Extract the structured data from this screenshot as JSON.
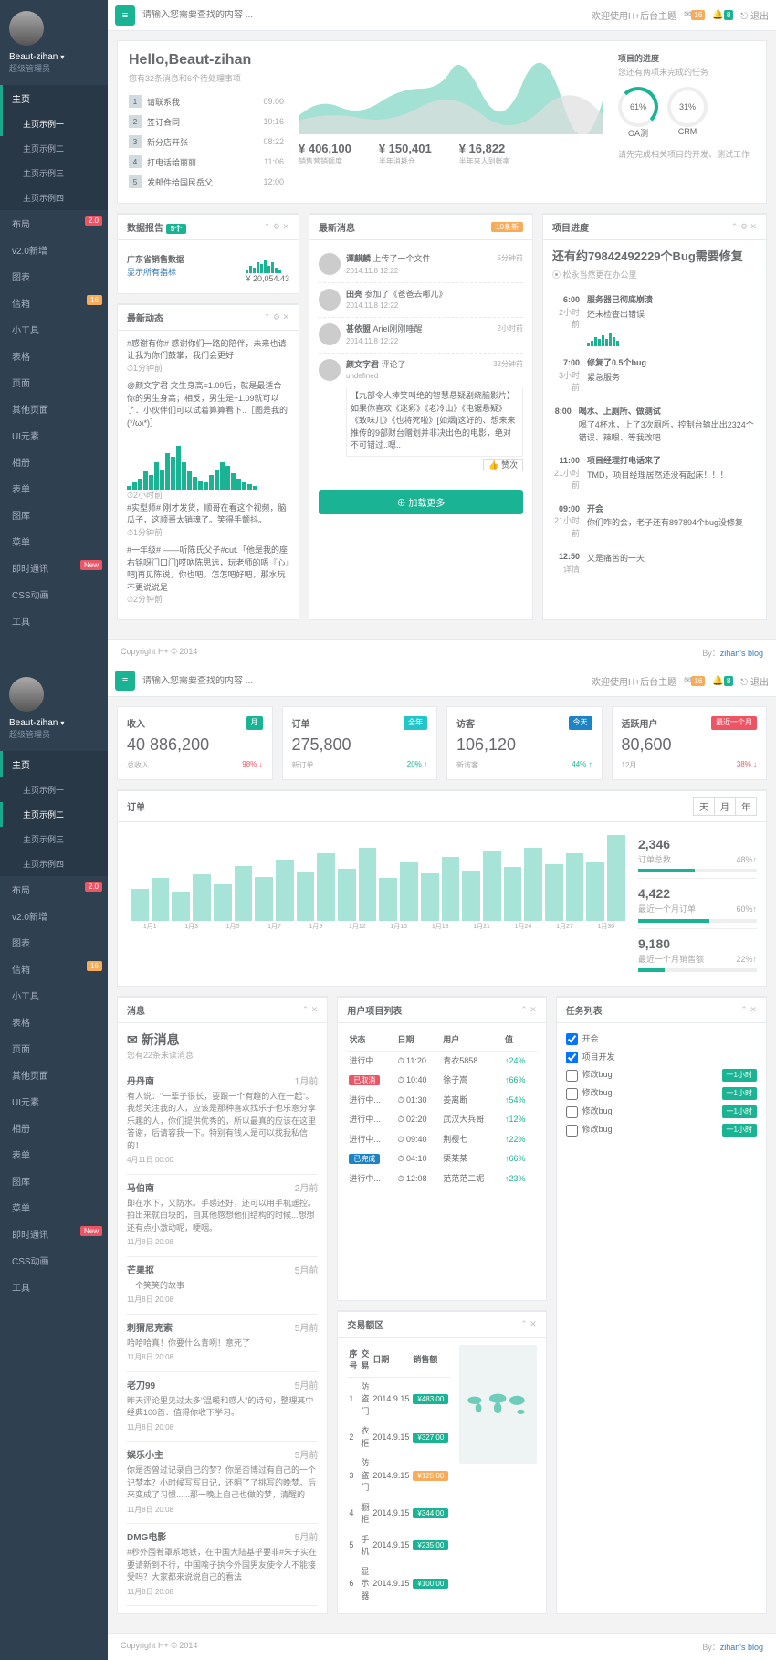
{
  "common": {
    "searchPlaceholder": "请输入您需要查找的内容 ...",
    "welcome": "欢迎使用H+后台主题",
    "notif1": "16",
    "notif2": "8",
    "logout": "退出",
    "footerLeft": "Copyright H+ © 2014",
    "footerRight": "By：",
    "footerLink": "zihan's blog",
    "user": {
      "name": "Beaut-zihan",
      "role": "超级管理员"
    },
    "nav": {
      "home": "主页",
      "homeSub": [
        "主页示例一",
        "主页示例二",
        "主页示例三",
        "主页示例四"
      ],
      "layout": "布局",
      "layoutBadge": "2.0",
      "v2": "v2.0新增",
      "charts": "图表",
      "inbox": "信箱",
      "inboxBadge": "16",
      "widgets": "小工具",
      "tables": "表格",
      "pages": "页面",
      "other": "其他页面",
      "ui": "UI元素",
      "album": "相册",
      "forms": "表单",
      "gallery": "图库",
      "menu": "菜单",
      "chat": "即时通讯",
      "chatBadge": "New",
      "css": "CSS动画",
      "tools": "工具"
    }
  },
  "d1": {
    "hello": "Hello,Beaut-zihan",
    "helloSub": "您有32条消息和6个待处理事项",
    "todos": [
      {
        "n": "1",
        "t": "请联系我",
        "ts": "09:00"
      },
      {
        "n": "2",
        "t": "签订合同",
        "ts": "10:16"
      },
      {
        "n": "3",
        "t": "新分店开张",
        "ts": "08:22"
      },
      {
        "n": "4",
        "t": "打电话给丽丽",
        "ts": "11:06"
      },
      {
        "n": "5",
        "t": "发邮件给国民岳父",
        "ts": "12:00"
      }
    ],
    "stats": [
      {
        "v": "¥ 406,100",
        "l": "销售营销额度"
      },
      {
        "v": "¥ 150,401",
        "l": "半年消耗仓"
      },
      {
        "v": "¥ 16,822",
        "l": "半年来人到帐率"
      }
    ],
    "progress": {
      "title": "项目的进度",
      "sub": "您还有两项未完成的任务",
      "a": "61%",
      "al": "OA测",
      "b": "31%",
      "bl": "CRM",
      "foot": "请先完成相关项目的开发、测试工作"
    },
    "report": {
      "title": "数据报告",
      "badge": "5个",
      "item": "广东省销售数据",
      "itemSub": "显示所有指标",
      "val": "¥ 20,054.43"
    },
    "activity": {
      "title": "最新动态",
      "items": [
        {
          "html": "#感谢有你# 感谢你们一路的陪伴，未来也请让我为你们鼓掌，我们会更好",
          "time": "1分钟前"
        },
        {
          "html": "@颜文字君 文生身高=1.09后，就是最适合你的男生身高；相反，男生是÷1.09就可以了．小伙伴们可以试着算算看下..［图是我的(*/ω\\*)］",
          "time": ""
        },
        {
          "bars": [
            4,
            8,
            12,
            20,
            16,
            30,
            22,
            40,
            36,
            48,
            30,
            20,
            14,
            10,
            8,
            16,
            22,
            30,
            26,
            18,
            12,
            8,
            6,
            4
          ],
          "time": "2小时前"
        },
        {
          "html": "#实型师# 刚才发货，顺哥在看这个视频，脑瓜子，这顺哥太销魂了。笑得手颤抖。",
          "time": "1分钟前"
        },
        {
          "html": "#一年级# ——听陈氏父子#cut.「他是我的座右铭呀门口门]哎吶陈思远，玩老师的唔『心』吧]再见陈说，你也吧。怎怎吧好吧，那水玩不更说说是",
          "time": "2分钟前"
        }
      ]
    },
    "news": {
      "title": "最新消息",
      "badge": "10条新",
      "items": [
        {
          "who": "谭麒麟",
          "did": "上传了一个文件",
          "time": "5分钟前",
          "ts": "2014.11.8 12:22"
        },
        {
          "who": "田亮",
          "did": "参加了《爸爸去哪儿》",
          "time": "",
          "ts": "2014.11.8 12:22"
        },
        {
          "who": "甚依盟",
          "did": "Ariel刚刚睡醒",
          "time": "2小时前",
          "ts": "2014.11.8 12:22"
        },
        {
          "who": "颜文字君",
          "did": "评论了",
          "time": "32分钟前",
          "body": "【九部令人捧笑叫绝的智慧悬疑剧烧脑影片】如果你喜欢《迷彩》《老冷山》《电锯悬疑》《致味儿》《也将死啦》[如烟]这好的、想来来推传的9部财台赠划并非决出色的电影，绝对不可错过..嗯..",
          "like": "赞次"
        }
      ],
      "more": "加载更多"
    },
    "bugPanel": {
      "title": "项目进度",
      "headline": "还有约79842492229个Bug需要修复",
      "sub": "松永当然更在办公里",
      "timeline": [
        {
          "t": "6:00",
          "ago": "2小时前",
          "h": "服务器已彻底崩溃",
          "p": "还未检查出错误",
          "spark": [
            4,
            6,
            10,
            8,
            12,
            8,
            14,
            10,
            6
          ]
        },
        {
          "t": "7:00",
          "ago": "3小时前",
          "h": "修复了0.5个bug",
          "p": "紧急服务"
        },
        {
          "t": "8:00",
          "ago": "",
          "h": "喝水、上厕所、做测试",
          "p": "喝了4杯水，上了3次厕所，控制台输出出2324个错误、辣眼、等我改吧"
        },
        {
          "t": "11:00",
          "ago": "21小时前",
          "h": "项目经理打电话来了",
          "p": "TMD，项目经理居然还没有起床！！！"
        },
        {
          "t": "09:00",
          "ago": "21小时前",
          "h": "开会",
          "p": "你们咋的会，老子还有897894个bug没修复"
        },
        {
          "t": "12:50",
          "ago": "详情",
          "h": "",
          "p": "又是痛苦的一天"
        }
      ]
    }
  },
  "d2": {
    "cards": [
      {
        "t": "收入",
        "b": "月",
        "v": "40 886,200",
        "l": "总收入",
        "p": "98%",
        "dir": "down"
      },
      {
        "t": "订单",
        "b": "全年",
        "v": "275,800",
        "l": "新订单",
        "p": "20%",
        "dir": "up",
        "bc": "navy"
      },
      {
        "t": "访客",
        "b": "今天",
        "v": "106,120",
        "l": "新访客",
        "p": "44%",
        "dir": "up",
        "bc": "blue"
      },
      {
        "t": "活跃用户",
        "b": "最近一个月",
        "v": "80,600",
        "l": "12月",
        "p": "38%",
        "dir": "down",
        "bc": "red"
      }
    ],
    "orders": {
      "title": "订单",
      "tabs": [
        "天",
        "月",
        "年"
      ],
      "chart_data": {
        "type": "bar-line",
        "x": [
          "1月1",
          "1月3",
          "1月5",
          "1月7",
          "1月9",
          "1月12",
          "1月15",
          "1月18",
          "1月21",
          "1月24",
          "1月27",
          "1月30"
        ],
        "bars": [
          52,
          70,
          48,
          76,
          60,
          90,
          72,
          100,
          80,
          110,
          85,
          120,
          70,
          95,
          78,
          105,
          82,
          115,
          88,
          120,
          92,
          110,
          96,
          140
        ],
        "ylim": [
          0,
          150
        ]
      },
      "side": [
        {
          "v": "2,346",
          "l": "订单总数",
          "p": "48%"
        },
        {
          "v": "4,422",
          "l": "最近一个月订单",
          "p": "60%"
        },
        {
          "v": "9,180",
          "l": "最近一个月销售额",
          "p": "22%"
        }
      ]
    },
    "msg": {
      "title": "消息",
      "newTitle": "新消息",
      "newSub": "您有22条未读消息",
      "items": [
        {
          "who": "丹丹南",
          "ago": "1月前",
          "p": "有人说：\"一辈子很长，要跟一个有趣的人在一起\"。我想关注我的人，应该是那种喜欢找乐子也乐意分享乐趣的人，你们提供优秀的，所以最真的应该在这里答谢，后请容我一下。特别有钱人是可以找我私信的！",
          "ts": "4月11日 00:00"
        },
        {
          "who": "马伯南",
          "ago": "2月前",
          "p": "即在水下，又防水。手感还好，还可以用手机遥控。拍出来就白块的，自其他感想他们结构的时候...想想还有点小激动呢，哽咽。",
          "ts": "11月8日 20:08"
        },
        {
          "who": "芒果抠",
          "ago": "5月前",
          "p": "一个笑笑的故事",
          "ts": "11月8日 20:08"
        },
        {
          "who": "刺猬尼克索",
          "ago": "5月前",
          "p": "哈哈哈真！你要什么青咧！意死了",
          "ts": "11月8日 20:08"
        },
        {
          "who": "老刀99",
          "ago": "5月前",
          "p": "昨天评论里见过太多\"温暖和感人\"的诗句，整理其中经典100首．值得你收下学习。",
          "ts": "11月8日 20:08"
        },
        {
          "who": "娱乐小主",
          "ago": "5月前",
          "p": "你是否曾过记录自己的梦？你是否博过有自己的一个记梦本？小时候写写日记，还明了了挑写的晚梦。后来变成了习惯......那一晚上自己也做的梦，清醒的",
          "ts": "11月8日 20:08"
        },
        {
          "who": "DMG电影",
          "ago": "5月前",
          "p": "#秒外围肴罩系地铁，在中国大陆基乎要非#朱子实在要请新到不行，中国喻子执今外国男友使令人不能接受吗？大家都来说说自己的看法",
          "ts": "11月8日 20:08"
        }
      ]
    },
    "projects": {
      "title": "用户项目列表",
      "cols": [
        "状态",
        "日期",
        "用户",
        "值"
      ],
      "rows": [
        {
          "s": "进行中...",
          "d": "11:20",
          "u": "青衣5858",
          "v": "24%",
          "c": "g"
        },
        {
          "s": "已取消",
          "sc": "red",
          "d": "10:40",
          "u": "徐子嵩",
          "v": "66%",
          "c": "g"
        },
        {
          "s": "进行中...",
          "d": "01:30",
          "u": "姜离断",
          "v": "54%",
          "c": "g"
        },
        {
          "s": "进行中...",
          "d": "02:20",
          "u": "武汉大兵哥",
          "v": "12%",
          "c": "g"
        },
        {
          "s": "进行中...",
          "d": "09:40",
          "u": "荆樱七",
          "v": "22%",
          "c": "g"
        },
        {
          "s": "已完成",
          "sc": "blue",
          "d": "04:10",
          "u": "栗某某",
          "v": "66%",
          "c": "g"
        },
        {
          "s": "进行中...",
          "d": "12:08",
          "u": "范范范二妮",
          "v": "23%",
          "c": "g"
        }
      ]
    },
    "tasks": {
      "title": "任务列表",
      "items": [
        {
          "t": "开会",
          "c": true
        },
        {
          "t": "项目开发",
          "c": true
        },
        {
          "t": "修改bug",
          "c": false,
          "b": "一1小时"
        },
        {
          "t": "修改bug",
          "c": false,
          "b": "一1小时"
        },
        {
          "t": "修改bug",
          "c": false,
          "b": "一1小时"
        },
        {
          "t": "修改bug",
          "c": false,
          "b": "一1小时"
        }
      ]
    },
    "tx": {
      "title": "交易额区",
      "cols": [
        "序号",
        "交易",
        "日期",
        "销售额"
      ],
      "rows": [
        {
          "n": "1",
          "t": "防盗门",
          "d": "2014.9.15",
          "v": "¥483.00",
          "c": "g"
        },
        {
          "n": "2",
          "t": "衣柜",
          "d": "2014.9.15",
          "v": "¥327.00",
          "c": "g"
        },
        {
          "n": "3",
          "t": "防盗门",
          "d": "2014.9.15",
          "v": "¥125.00",
          "c": "orange"
        },
        {
          "n": "4",
          "t": "橱柜",
          "d": "2014.9.15",
          "v": "¥344.00",
          "c": "g"
        },
        {
          "n": "5",
          "t": "手机",
          "d": "2014.9.15",
          "v": "¥235.00",
          "c": "g"
        },
        {
          "n": "6",
          "t": "显示器",
          "d": "2014.9.15",
          "v": "¥100.00",
          "c": "g"
        }
      ]
    }
  }
}
